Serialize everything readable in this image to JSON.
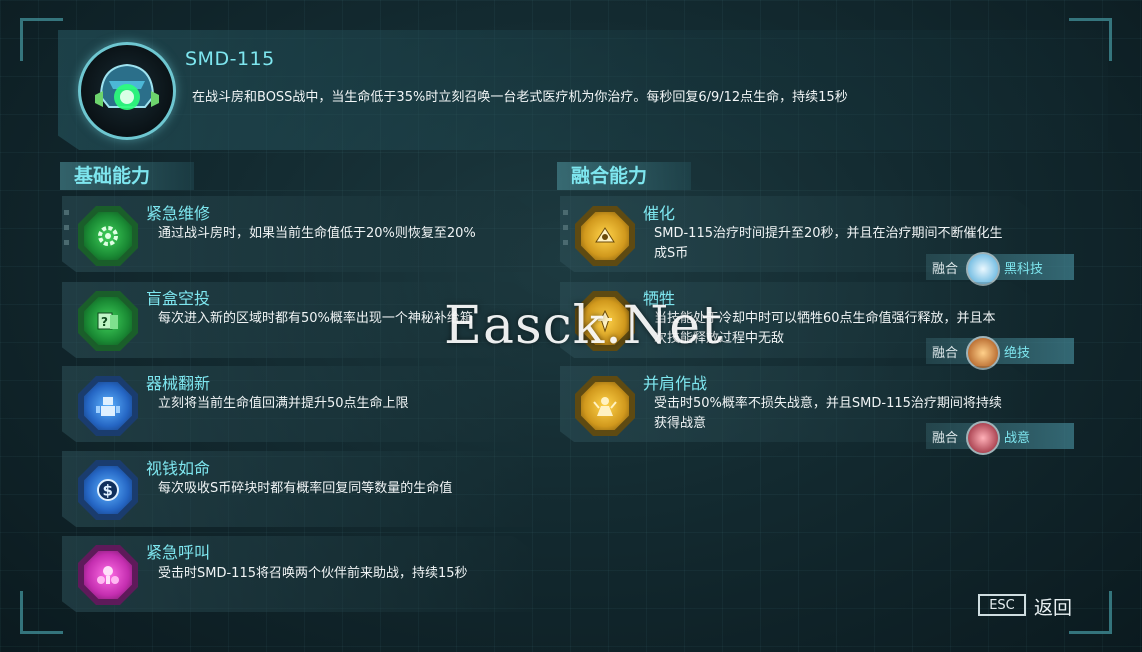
{
  "companion": {
    "name": "SMD-115",
    "description": "在战斗房和BOSS战中，当生命低于35%时立刻召唤一台老式医疗机为你治疗。每秒回复6/9/12点生命，持续15秒"
  },
  "sections": {
    "basic_title": "基础能力",
    "fusion_title": "融合能力"
  },
  "basic_abilities": [
    {
      "name": "紧急维修",
      "desc": "通过战斗房时，如果当前生命值低于20%则恢复至20%",
      "icon": "gear-repair-icon",
      "color": "green"
    },
    {
      "name": "盲盒空投",
      "desc": "每次进入新的区域时都有50%概率出现一个神秘补给箱",
      "icon": "mystery-box-icon",
      "color": "green"
    },
    {
      "name": "器械翻新",
      "desc": "立刻将当前生命值回满并提升50点生命上限",
      "icon": "robot-upgrade-icon",
      "color": "blue"
    },
    {
      "name": "视钱如命",
      "desc": "每次吸收S币碎块时都有概率回复同等数量的生命值",
      "icon": "dollar-coin-icon",
      "color": "blue"
    },
    {
      "name": "紧急呼叫",
      "desc": "受击时SMD-115将召唤两个伙伴前来助战，持续15秒",
      "icon": "drone-call-icon",
      "color": "magenta"
    }
  ],
  "fusion_abilities": [
    {
      "name": "催化",
      "desc": "SMD-115治疗时间提升至20秒，并且在治疗期间不断催化生成S币",
      "icon": "catalyst-icon",
      "fusion_label": "融合",
      "fusion_partner": "黑科技",
      "partner_icon": "tech-cube-icon",
      "partner_color": "#8fd8ff"
    },
    {
      "name": "牺牲",
      "desc": "当技能处于冷却中时可以牺牲60点生命值强行释放，并且本次技能释放过程中无敌",
      "icon": "sacrifice-icon",
      "fusion_label": "融合",
      "fusion_partner": "绝技",
      "partner_icon": "ultimate-skill-icon",
      "partner_color": "#e0842a"
    },
    {
      "name": "并肩作战",
      "desc": "受击时50%概率不损失战意，并且SMD-115治疗期间将持续获得战意",
      "icon": "fight-together-icon",
      "fusion_label": "融合",
      "fusion_partner": "战意",
      "partner_icon": "fighting-spirit-icon",
      "partner_color": "#e0404a"
    }
  ],
  "footer": {
    "esc_label": "ESC",
    "back_label": "返回"
  },
  "watermark": "Easck.Net",
  "colors": {
    "accent": "#7ee6ef",
    "green": "#3fd05a",
    "blue": "#2566c4",
    "magenta": "#c42eb0",
    "gold": "#d1991d"
  }
}
